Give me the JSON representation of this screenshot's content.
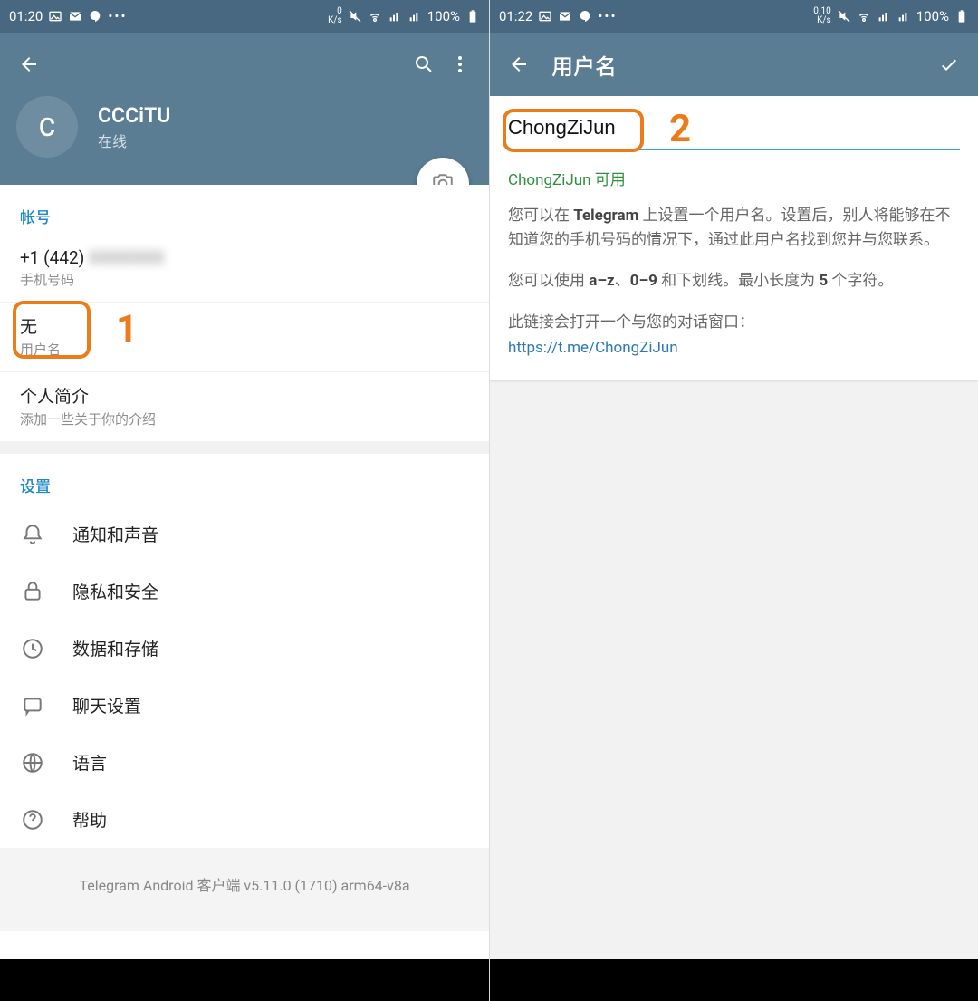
{
  "left": {
    "status": {
      "time": "01:20",
      "net": "0\nK/s",
      "battery": "100%"
    },
    "profile": {
      "initial": "C",
      "name": "CCCiTU",
      "status": "在线"
    },
    "account": {
      "section": "帐号",
      "phone_prefix": "+1 (442) ",
      "phone_rest": "XXXXXXX",
      "phone_label": "手机号码",
      "username_value": "无",
      "username_label": "用户名",
      "bio_title": "个人简介",
      "bio_hint": "添加一些关于你的介绍"
    },
    "settings": {
      "section": "设置",
      "items": [
        {
          "label": "通知和声音",
          "icon": "bell"
        },
        {
          "label": "隐私和安全",
          "icon": "lock"
        },
        {
          "label": "数据和存储",
          "icon": "clock"
        },
        {
          "label": "聊天设置",
          "icon": "chat"
        },
        {
          "label": "语言",
          "icon": "globe"
        },
        {
          "label": "帮助",
          "icon": "help"
        }
      ]
    },
    "version": "Telegram Android 客户端 v5.11.0 (1710) arm64-v8a",
    "annotation": "1"
  },
  "right": {
    "status": {
      "time": "01:22",
      "net": "0.10\nK/s",
      "battery": "100%"
    },
    "title": "用户名",
    "input_value": "ChongZiJun",
    "available": "ChongZiJun 可用",
    "desc1_a": "您可以在 ",
    "desc1_b": "Telegram",
    "desc1_c": " 上设置一个用户名。设置后，别人将能够在不知道您的手机号码的情况下，通过此用户名找到您并与您联系。",
    "desc2_a": "您可以使用 ",
    "desc2_b": "a–z",
    "desc2_c": "、",
    "desc2_d": "0–9",
    "desc2_e": " 和下划线。最小长度为 ",
    "desc2_f": "5",
    "desc2_g": " 个字符。",
    "desc3": "此链接会打开一个与您的对话窗口：",
    "link": "https://t.me/ChongZiJun",
    "annotation": "2"
  }
}
